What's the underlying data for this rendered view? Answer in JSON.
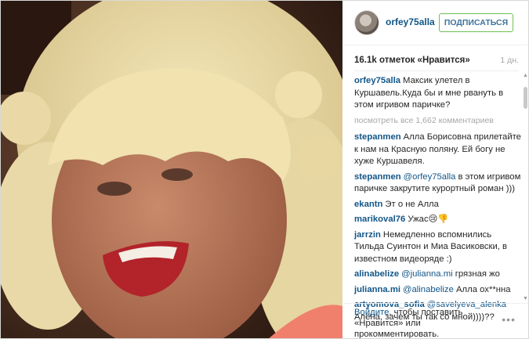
{
  "header": {
    "username": "orfey75alla",
    "follow_label": "ПОДПИСАТЬСЯ"
  },
  "stats": {
    "likes": "16.1k отметок «Нравится»",
    "age": "1 дн."
  },
  "caption": {
    "user": "orfey75alla",
    "text": "Максик улетел в Куршавель.Куда бы и мне рвануть в этом игривом паричке?"
  },
  "view_all": "посмотреть все 1,662 комментариев",
  "comments": [
    {
      "user": "stepanmen",
      "mention": "",
      "text": "Алла Борисовна прилетайте к нам на Красную поляну. Ей богу не хуже Куршавеля."
    },
    {
      "user": "stepanmen",
      "mention": "@orfey75alla",
      "text": "в этом игривом паричке закрутите курортный роман )))"
    },
    {
      "user": "ekantn",
      "mention": "",
      "text": "Эт о не Алла"
    },
    {
      "user": "marikoval76",
      "mention": "",
      "text": "Ужас😢👎"
    },
    {
      "user": "jarrzin",
      "mention": "",
      "text": "Немедленно вспомнились Тильда Суинтон и Миа Васиковски, в известном видеоряде :)"
    },
    {
      "user": "alinabelize",
      "mention": "@julianna.mi",
      "text": "грязная жо"
    },
    {
      "user": "julianna.mi",
      "mention": "@alinabelize",
      "text": "Алла ох**нна"
    },
    {
      "user": "artyomova_sofia",
      "mention": "@savelyeva_alenka",
      "text": "Алёна, зачем ты так со мной))))??"
    }
  ],
  "footer": {
    "login_link": "Войдите",
    "rest": ", чтобы поставить «Нравится» или прокомментировать.",
    "more_icon": "•••"
  },
  "colors": {
    "link": "#125688",
    "follow_border": "#70c050",
    "muted": "#a5a7aa"
  }
}
